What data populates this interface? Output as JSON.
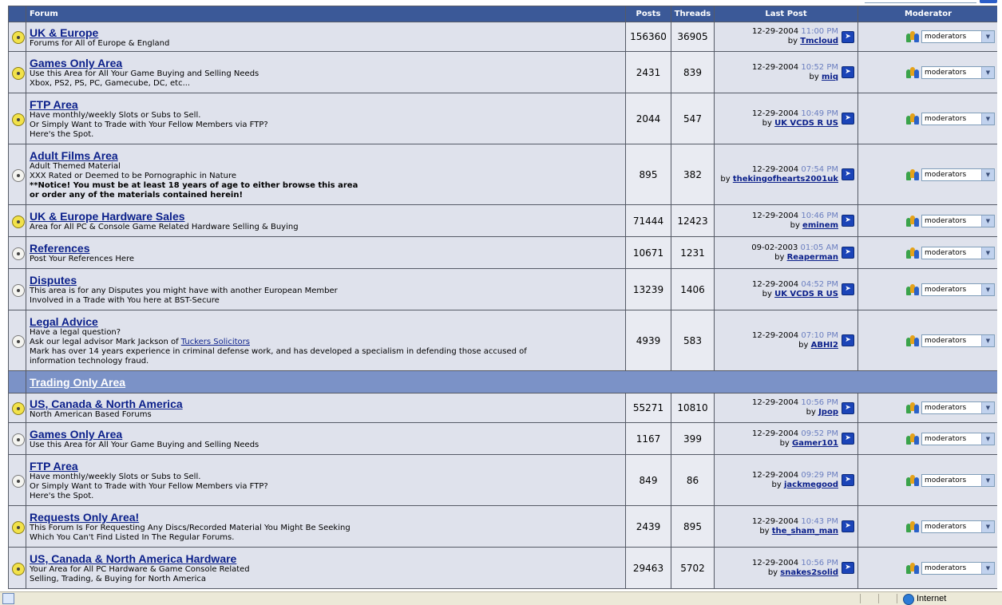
{
  "headers": {
    "forum": "Forum",
    "posts": "Posts",
    "threads": "Threads",
    "last_post": "Last Post",
    "moderator": "Moderator"
  },
  "moderator_label": "moderators",
  "go_icon": "arrow-right-icon",
  "status_bar": {
    "zone": "Internet"
  },
  "rows": [
    {
      "type": "forum",
      "icon": "on",
      "name": "UK & Europe",
      "desc": [
        "Forums for All of Europe & England"
      ],
      "posts": "156360",
      "threads": "36905",
      "date": "12-29-2004",
      "time": "11:00 PM",
      "user": "Tmcloud",
      "h": 36
    },
    {
      "type": "forum",
      "icon": "on",
      "name": "Games Only Area",
      "desc": [
        "Use this Area for All Your Game Buying and Selling Needs",
        "Xbox, PS2, PS, PC, Gamecube, DC, etc..."
      ],
      "posts": "2431",
      "threads": "839",
      "date": "12-29-2004",
      "time": "10:52 PM",
      "user": "miq",
      "h": 51
    },
    {
      "type": "forum",
      "icon": "on",
      "name": "FTP Area",
      "desc": [
        "Have monthly/weekly Slots or Subs to Sell.",
        "Or Simply Want to Trade with Your Fellow Members via FTP?",
        "Here's the Spot."
      ],
      "posts": "2044",
      "threads": "547",
      "date": "12-29-2004",
      "time": "10:49 PM",
      "user": "UK VCDS R US",
      "h": 63
    },
    {
      "type": "forum",
      "icon": "off",
      "name": "Adult Films Area",
      "desc": [
        "Adult Themed Material",
        "XXX Rated or Deemed to be Pornographic in Nature"
      ],
      "desc_bold": [
        "**Notice! You must be at least 18 years of age to either browse this area",
        "or order any of the materials contained herein!"
      ],
      "posts": "895",
      "threads": "382",
      "date": "12-29-2004",
      "time": "07:54 PM",
      "user": "thekingofhearts2001uk",
      "h": 75
    },
    {
      "type": "forum",
      "icon": "on",
      "name": "UK & Europe Hardware Sales",
      "desc": [
        "Area for All PC & Console Game Related Hardware Selling & Buying"
      ],
      "posts": "71444",
      "threads": "12423",
      "date": "12-29-2004",
      "time": "10:46 PM",
      "user": "eminem",
      "h": 39
    },
    {
      "type": "forum",
      "icon": "off",
      "name": "References",
      "desc": [
        "Post Your References Here"
      ],
      "posts": "10671",
      "threads": "1231",
      "date": "09-02-2003",
      "time": "01:05 AM",
      "user": "Reaperman",
      "h": 39
    },
    {
      "type": "forum",
      "icon": "off",
      "name": "Disputes",
      "desc": [
        "This area is for any Disputes you might have with another European Member",
        "Involved in a Trade with You here at BST-Secure"
      ],
      "posts": "13239",
      "threads": "1406",
      "date": "12-29-2004",
      "time": "04:52 PM",
      "user": "UK VCDS R US",
      "h": 51
    },
    {
      "type": "forum",
      "icon": "off",
      "name": "Legal Advice",
      "desc": [
        "Have a legal question?"
      ],
      "desc_link": {
        "prefix": "Ask our legal advisor Mark Jackson of ",
        "link": "Tuckers Solicitors"
      },
      "desc_after": [
        "Mark has over 14 years experience in criminal defense work, and has developed a specialism in defending those accused of",
        "information technology fraud."
      ],
      "posts": "4939",
      "threads": "583",
      "date": "12-29-2004",
      "time": "07:10 PM",
      "user": "ABHI2",
      "h": 75
    },
    {
      "type": "section",
      "name": "Trading Only Area",
      "h": 27
    },
    {
      "type": "forum",
      "icon": "on",
      "name": "US, Canada & North America",
      "desc": [
        "North American Based Forums"
      ],
      "posts": "55271",
      "threads": "10810",
      "date": "12-29-2004",
      "time": "10:56 PM",
      "user": "Jpop",
      "h": 36
    },
    {
      "type": "forum",
      "icon": "off",
      "name": "Games Only Area",
      "desc": [
        "Use this Area for All Your Game Buying and Selling Needs"
      ],
      "posts": "1167",
      "threads": "399",
      "date": "12-29-2004",
      "time": "09:52 PM",
      "user": "Gamer101",
      "h": 39
    },
    {
      "type": "forum",
      "icon": "off",
      "name": "FTP Area",
      "desc": [
        "Have monthly/weekly Slots or Subs to Sell.",
        "Or Simply Want to Trade with Your Fellow Members via FTP?",
        "Here's the Spot."
      ],
      "posts": "849",
      "threads": "86",
      "date": "12-29-2004",
      "time": "09:29 PM",
      "user": "jackmegood",
      "h": 63
    },
    {
      "type": "forum",
      "icon": "on",
      "name": "Requests Only Area!",
      "desc": [
        "This Forum Is For Requesting Any Discs/Recorded Material You Might Be Seeking",
        "Which You Can't Find Listed In The Regular Forums."
      ],
      "posts": "2439",
      "threads": "895",
      "date": "12-29-2004",
      "time": "10:43 PM",
      "user": "the_sham_man",
      "h": 51
    },
    {
      "type": "forum",
      "icon": "on",
      "name": "US, Canada & North America Hardware",
      "desc": [
        "Your Area for All PC Hardware & Game Console Related",
        "Selling, Trading, & Buying for North America"
      ],
      "posts": "29463",
      "threads": "5702",
      "date": "12-29-2004",
      "time": "10:56 PM",
      "user": "snakes2solid",
      "h": 51
    }
  ]
}
